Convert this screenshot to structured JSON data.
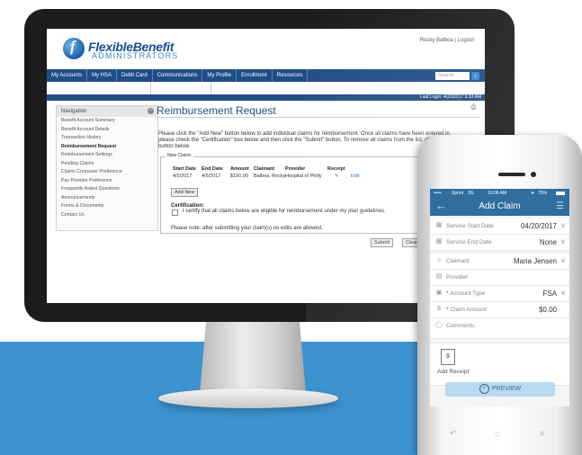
{
  "desktop": {
    "user_name": "Rocky Balboa",
    "logout_label": "Logout",
    "logo": {
      "word1": "FlexibleBenefit",
      "word2": "ADMINISTRATORS"
    },
    "nav": [
      "My Accounts",
      "My HSA",
      "Debit Card",
      "Communications",
      "My Profile",
      "Enrollment",
      "Resources"
    ],
    "search_placeholder": "Search",
    "last_login": "Last Login: 4/20/2017 9:33 AM",
    "sidebar": {
      "title": "Navigation",
      "items": [
        "Benefit Account Summary",
        "Benefit Account Details",
        "Transaction History",
        "Reimbursement Request",
        "Reimbursement Settings",
        "Pending Claims",
        "Claims Crossover Preference",
        "Pay Provider Preference",
        "Frequently Asked Questions",
        "Announcements",
        "Forms & Documents",
        "Contact Us"
      ],
      "active_index": 3
    },
    "page_title": "Reimbursement Request",
    "intro": "Please click the \"Add New\" button below to add individual claims for reimbursement.  Once all claims have been entered in, please check the \"Certification\" box below and then click the \"Submit\" button.  To remove all claims from the list, click the \"Clear\" button below.",
    "fieldset_legend": "New Claims",
    "table": {
      "headers": [
        "Start Date",
        "End Date",
        "Amount",
        "Claimant",
        "Provider",
        "Receipt"
      ],
      "row": [
        "4/5/2017",
        "4/5/2017",
        "$150.00",
        "Balboa, Rocky",
        "Hospital of Philly",
        "",
        "Edit"
      ]
    },
    "add_new_label": "Add New",
    "certification_title": "Certification:",
    "certification_text": "I certify that all claims below are eligible for reimbursement under my plan guidelines.",
    "note": "Please note: after submitting your claim(s) no edits are allowed.",
    "submit_label": "Submit",
    "clear_label": "Clear"
  },
  "phone": {
    "status": {
      "carrier": "Sprint",
      "network": "3G",
      "time": "10:06 AM",
      "battery": "75%"
    },
    "title": "Add Claim",
    "fields": [
      {
        "label": "Service Start Date",
        "value": "04/20/2017",
        "icon": "calendar-icon",
        "required": false
      },
      {
        "label": "Service End Date",
        "value": "None",
        "icon": "calendar-icon",
        "required": false
      },
      {
        "label": "Claimant",
        "value": "Maria Jensen",
        "icon": "person-icon",
        "required": false
      },
      {
        "label": "Provider",
        "value": "",
        "icon": "provider-icon",
        "required": false
      },
      {
        "label": "Account Type",
        "value": "FSA",
        "icon": "wallet-icon",
        "required": true
      },
      {
        "label": "Claim Amount",
        "value": "$0.00",
        "icon": "dollar-icon",
        "required": true
      },
      {
        "label": "Comments",
        "value": "",
        "icon": "comment-icon",
        "required": false
      }
    ],
    "add_receipt_label": "Add Receipt",
    "preview_label": "PREVIEW"
  },
  "colors": {
    "brand_navy": "#1f4e86",
    "phone_header": "#2f6e9f",
    "background_band": "#3c93d0",
    "preview_button": "#b8d9ef"
  }
}
